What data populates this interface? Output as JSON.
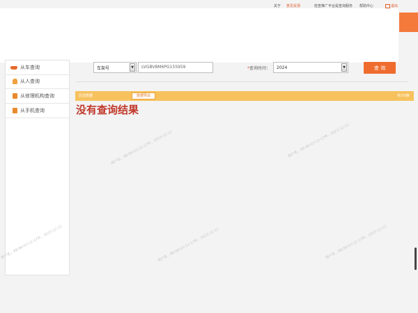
{
  "topbar": {
    "links": [
      "关于",
      "意见反馈",
      "检查推广平台是查询服务",
      "帮助中心",
      "退出"
    ]
  },
  "sidebar": {
    "items": [
      {
        "label": "从车查询",
        "icon": "car-icon"
      },
      {
        "label": "从人查询",
        "icon": "person-icon"
      },
      {
        "label": "从修理机构查询",
        "icon": "document-icon"
      },
      {
        "label": "从手机查询",
        "icon": "document-icon"
      }
    ]
  },
  "form": {
    "plate_type": "车架号",
    "vin_value": "LVGBV8M6PG155959",
    "time_label": "查询时间：",
    "time_required": "*",
    "year_value": "2024",
    "query_label": "查 询"
  },
  "results": {
    "title": "历史数据",
    "export_label": "数据导出",
    "count_text": "共计0条",
    "empty_message": "没有查询结果"
  },
  "watermark": {
    "text": "用户名，8B-88-03-12-17件，2023-12-12"
  },
  "colors": {
    "accent": "#ef6c2e",
    "result_bar": "#f7c25e",
    "empty_text": "#c0392b"
  }
}
